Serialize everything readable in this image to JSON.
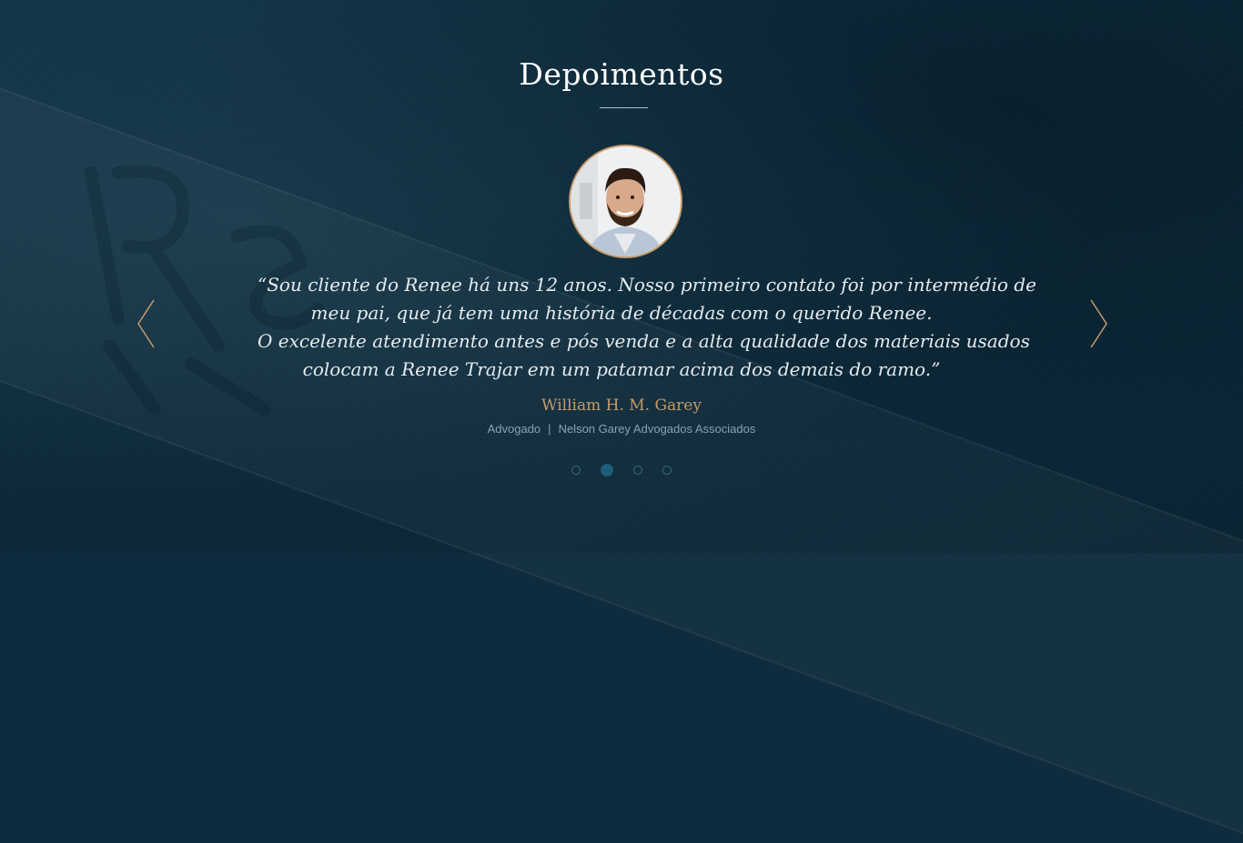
{
  "section": {
    "title": "Depoimentos"
  },
  "testimonial": {
    "quote_lines": [
      "“Sou cliente do Renee há uns 12 anos. Nosso primeiro contato foi por intermédio de",
      "meu pai, que já tem uma história de décadas com o querido Renee.",
      "O excelente atendimento antes e pós venda e a alta qualidade dos materiais usados",
      "colocam a Renee Trajar em um patamar acima dos demais do ramo.”"
    ],
    "author": "William H. M. Garey",
    "role": "Advogado",
    "separator": "|",
    "company": "Nelson Garey Advogados Associados"
  },
  "carousel": {
    "slide_count": 4,
    "active_index": 1
  },
  "icons": {
    "prev": "chevron-left-icon",
    "next": "chevron-right-icon"
  },
  "colors": {
    "background": "#0e2c3d",
    "accent_gold": "#c79a6a",
    "text_light": "#e4ebef",
    "dot_active": "#1f5d7c"
  }
}
